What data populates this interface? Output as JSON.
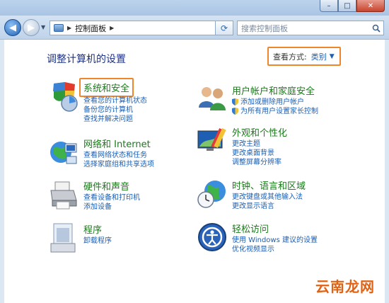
{
  "window": {
    "buttons": {
      "minimize": "–",
      "maximize": "□",
      "close": "✕"
    }
  },
  "nav": {
    "back_icon": "back-arrow-icon",
    "forward_icon": "forward-arrow-icon",
    "breadcrumb": [
      "控制面板"
    ],
    "search_placeholder": "搜索控制面板"
  },
  "header": {
    "title": "调整计算机的设置",
    "view_by_label": "查看方式:",
    "view_by_value": "类别"
  },
  "categories": [
    {
      "title": "系统和安全",
      "links": [
        {
          "text": "查看您的计算机状态",
          "shield": false
        },
        {
          "text": "备份您的计算机",
          "shield": false
        },
        {
          "text": "查找并解决问题",
          "shield": false
        }
      ]
    },
    {
      "title": "网络和 Internet",
      "links": [
        {
          "text": "查看网络状态和任务",
          "shield": false
        },
        {
          "text": "选择家庭组和共享选项",
          "shield": false
        }
      ]
    },
    {
      "title": "硬件和声音",
      "links": [
        {
          "text": "查看设备和打印机",
          "shield": false
        },
        {
          "text": "添加设备",
          "shield": false
        }
      ]
    },
    {
      "title": "程序",
      "links": [
        {
          "text": "卸载程序",
          "shield": false
        }
      ]
    },
    {
      "title": "用户帐户和家庭安全",
      "links": [
        {
          "text": "添加或删除用户帐户",
          "shield": true
        },
        {
          "text": "为所有用户设置家长控制",
          "shield": true
        }
      ]
    },
    {
      "title": "外观和个性化",
      "links": [
        {
          "text": "更改主题",
          "shield": false
        },
        {
          "text": "更改桌面背景",
          "shield": false
        },
        {
          "text": "调整屏幕分辨率",
          "shield": false
        }
      ]
    },
    {
      "title": "时钟、语言和区域",
      "links": [
        {
          "text": "更改键盘或其他输入法",
          "shield": false
        },
        {
          "text": "更改显示语言",
          "shield": false
        }
      ]
    },
    {
      "title": "轻松访问",
      "links": [
        {
          "text": "使用 Windows 建议的设置",
          "shield": false
        },
        {
          "text": "优化视频显示",
          "shield": false
        }
      ]
    }
  ],
  "watermark": "云南龙网",
  "colors": {
    "accent": "#1b5fb4",
    "category_green": "#1a7a1a",
    "highlight": "#f0862a",
    "title_blue": "#1e3287"
  }
}
